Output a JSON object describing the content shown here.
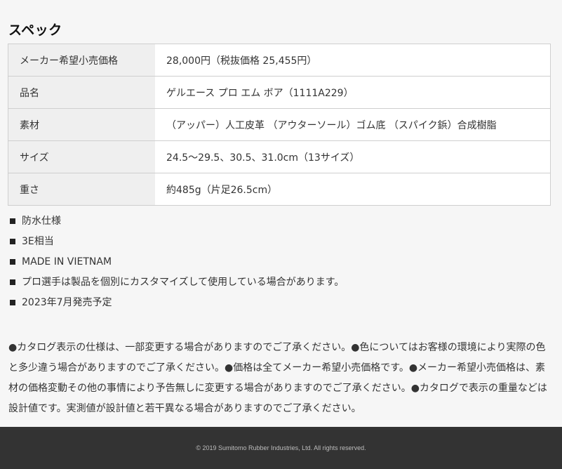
{
  "section_title": "スペック",
  "spec_rows": [
    {
      "label": "メーカー希望小売価格",
      "value": "28,000円（税抜価格 25,455円）"
    },
    {
      "label": "品名",
      "value": "ゲルエース プロ エム ボア（1111A229）"
    },
    {
      "label": "素材",
      "value": "（アッパー）人工皮革 （アウターソール）ゴム底 （スパイク鋲）合成樹脂"
    },
    {
      "label": "サイズ",
      "value": "24.5～29.5、30.5、31.0cm（13サイズ）"
    },
    {
      "label": "重さ",
      "value": "約485g（片足26.5cm）"
    }
  ],
  "features": [
    "防水仕様",
    "3E相当",
    "MADE IN VIETNAM",
    "プロ選手は製品を個別にカスタマイズして使用している場合があります。",
    "2023年7月発売予定"
  ],
  "notes": "●カタログ表示の仕様は、一部変更する場合がありますのでご了承ください。●色についてはお客様の環境により実際の色と多少違う場合がありますのでご了承ください。●価格は全てメーカー希望小売価格です。●メーカー希望小売価格は、素材の価格変動その他の事情により予告無しに変更する場合がありますのでご了承ください。●カタログで表示の重量などは設計値です。実測値が設計値と若干異なる場合がありますのでご了承ください。",
  "footer": {
    "copyright": "© 2019 Sumitomo Rubber Industries, Ltd. All rights reserved."
  }
}
